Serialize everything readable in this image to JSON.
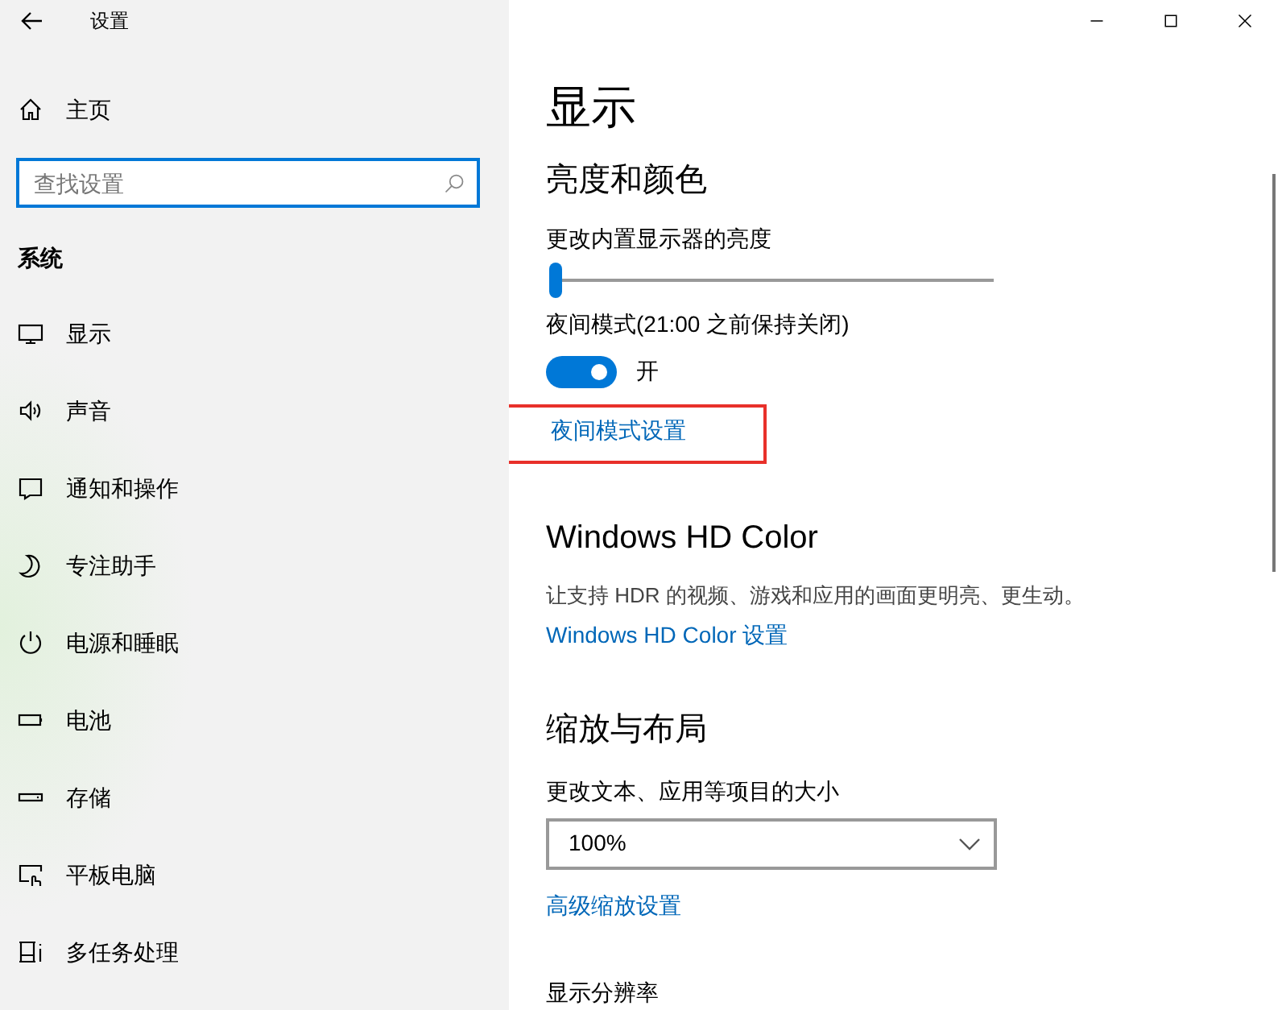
{
  "window": {
    "title": "设置"
  },
  "sidebar": {
    "home": "主页",
    "search": {
      "placeholder": "查找设置",
      "focused": true
    },
    "section": "系统",
    "items": [
      {
        "label": "显示"
      },
      {
        "label": "声音"
      },
      {
        "label": "通知和操作"
      },
      {
        "label": "专注助手"
      },
      {
        "label": "电源和睡眠"
      },
      {
        "label": "电池"
      },
      {
        "label": "存储"
      },
      {
        "label": "平板电脑"
      },
      {
        "label": "多任务处理"
      }
    ]
  },
  "page": {
    "title": "显示",
    "brightness": {
      "heading": "亮度和颜色",
      "label": "更改内置显示器的亮度",
      "level": 0.0
    },
    "night_light": {
      "label": "夜间模式(21:00 之前保持关闭)",
      "on": true,
      "state_text": "开",
      "link": "夜间模式设置",
      "highlighted": true
    },
    "hd_color": {
      "heading": "Windows HD Color",
      "description": "让支持 HDR 的视频、游戏和应用的画面更明亮、更生动。",
      "link": "Windows HD Color 设置"
    },
    "scale": {
      "heading": "缩放与布局",
      "label": "更改文本、应用等项目的大小",
      "value": "100%",
      "link": "高级缩放设置",
      "next_label": "显示分辨率"
    }
  }
}
